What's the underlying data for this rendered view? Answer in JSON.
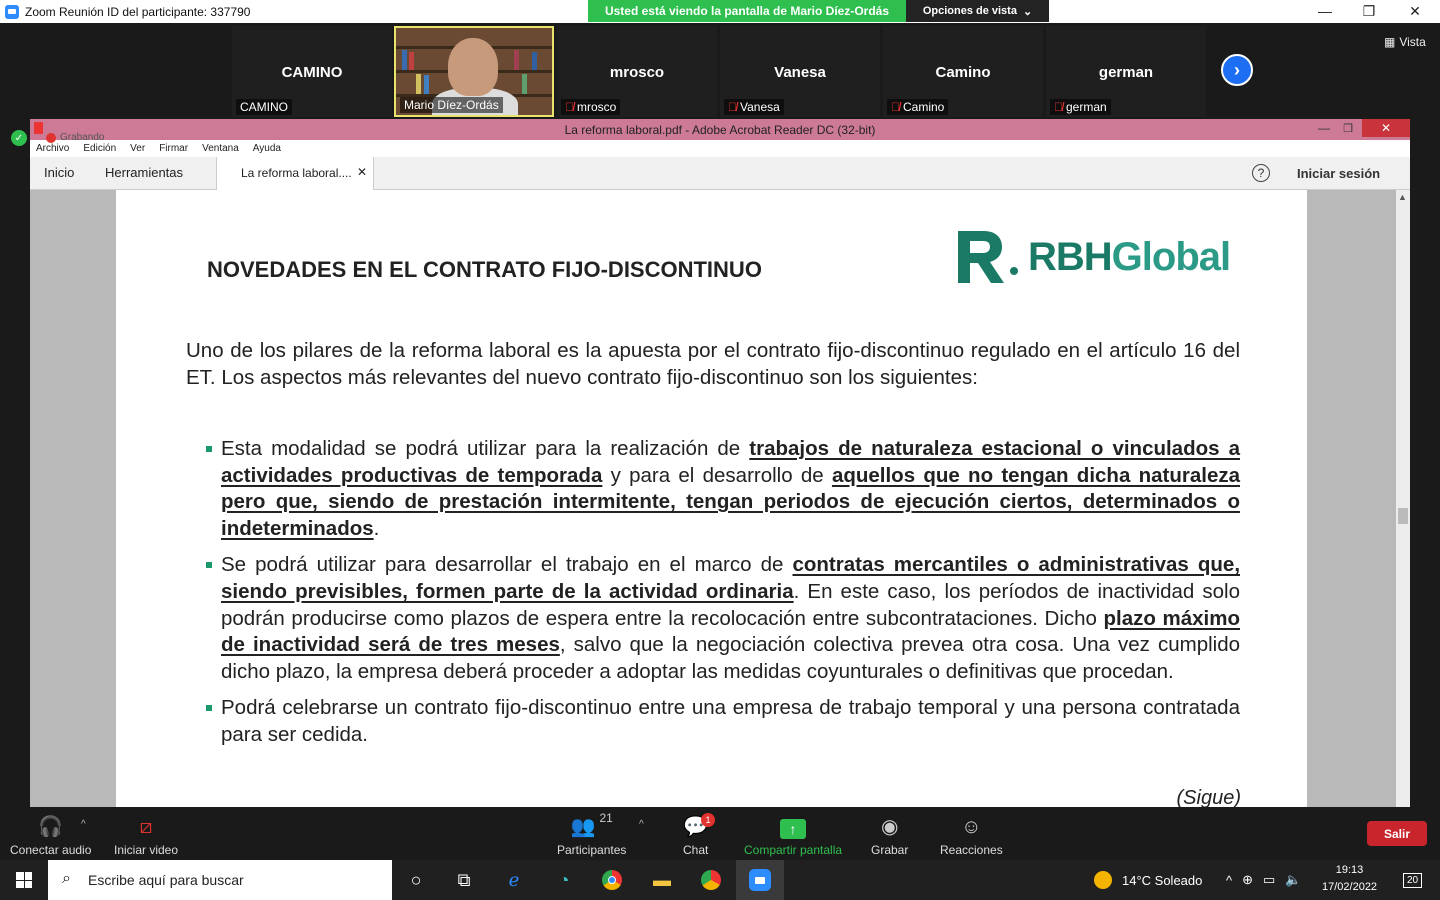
{
  "zoom": {
    "window_title": "Zoom Reunión ID del participante: 337790",
    "share_banner": "Usted está viendo la pantalla de Mario Díez-Ordás",
    "view_options": "Opciones de vista",
    "vista_label": "Vista",
    "participants": [
      {
        "big_name": "CAMINO",
        "caption": "CAMINO",
        "muted": false
      },
      {
        "big_name": "",
        "caption": "Mario Díez-Ordás",
        "muted": false,
        "video": true
      },
      {
        "big_name": "mrosco",
        "caption": "mrosco",
        "muted": true
      },
      {
        "big_name": "Vanesa",
        "caption": "Vanesa",
        "muted": true
      },
      {
        "big_name": "Camino",
        "caption": "Camino",
        "muted": true
      },
      {
        "big_name": "german",
        "caption": "german",
        "muted": true
      }
    ],
    "controls": {
      "audio": "Conectar audio",
      "video": "Iniciar video",
      "participants": "Participantes",
      "participants_count": "21",
      "chat": "Chat",
      "chat_badge": "1",
      "share": "Compartir pantalla",
      "record": "Grabar",
      "reactions": "Reacciones",
      "leave": "Salir"
    }
  },
  "acrobat": {
    "window_title": "La reforma laboral.pdf - Adobe Acrobat Reader DC (32-bit)",
    "recording_label": "Grabando",
    "menu": [
      "Archivo",
      "Edición",
      "Ver",
      "Firmar",
      "Ventana",
      "Ayuda"
    ],
    "tabs": {
      "home": "Inicio",
      "tools": "Herramientas",
      "document": "La reforma laboral...."
    },
    "help": "?",
    "signin": "Iniciar sesión"
  },
  "document": {
    "title": "NOVEDADES EN EL CONTRATO FIJO-DISCONTINUO",
    "logo_text_a": "RBH",
    "logo_text_b": "Global",
    "intro": "Uno de los pilares de la reforma laboral es la apuesta por el contrato fijo-discontinuo regulado en el artículo 16 del ET. Los aspectos más relevantes del nuevo contrato fijo-discontinuo son los siguientes:",
    "bullet1": {
      "a": "Esta modalidad se podrá utilizar para la realización de ",
      "b": "trabajos de naturaleza estacional o vinculados a actividades productivas de temporada",
      "c": " y para el desarrollo de ",
      "d": "aquellos que no tengan dicha naturaleza pero que, siendo de prestación intermitente, tengan periodos de ejecución ciertos, determinados o indeterminados",
      "e": "."
    },
    "bullet2": {
      "a": "Se podrá utilizar para desarrollar el trabajo en el marco de ",
      "b": "contratas mercantiles o administrativas que, siendo previsibles, formen parte de la actividad ordinaria",
      "c": ". En este caso, los períodos de inactividad solo podrán producirse como plazos de espera entre la recolocación entre subcontrataciones. Dicho ",
      "d": "plazo máximo de inactividad será de tres meses",
      "e": ", salvo que la negociación colectiva prevea otra cosa. Una vez cumplido dicho plazo, la empresa deberá proceder a adoptar las medidas coyunturales o definitivas que procedan."
    },
    "bullet3": "Podrá celebrarse un contrato fijo-discontinuo entre una empresa de trabajo temporal y una persona contratada para ser cedida.",
    "continues": "(Sigue)"
  },
  "taskbar": {
    "search_placeholder": "Escribe aquí para buscar",
    "weather": "14°C  Soleado",
    "time": "19:13",
    "date": "17/02/2022",
    "notifications": "20"
  }
}
